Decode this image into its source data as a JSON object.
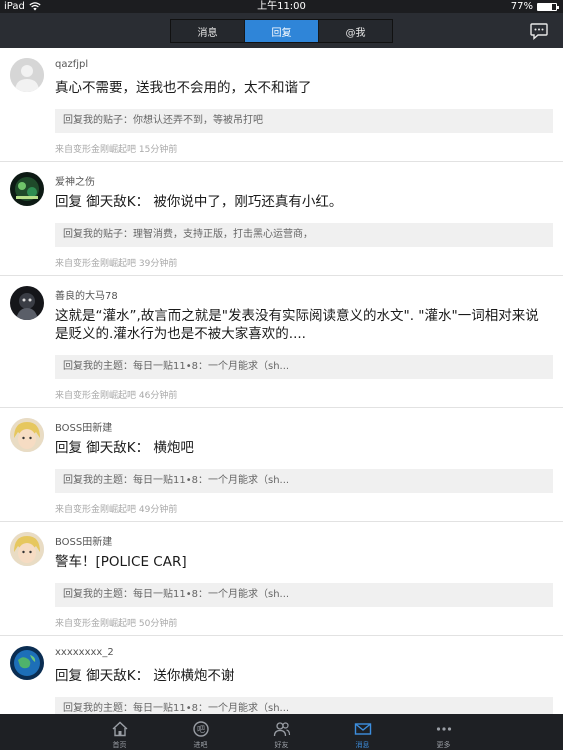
{
  "status": {
    "device": "iPad",
    "time": "上午11:00",
    "battery": "77%",
    "battery_level": 0.77
  },
  "nav": {
    "segments": [
      "消息",
      "回复",
      "@我"
    ],
    "active_segment": 1,
    "chat_icon": "chat-bubble-icon"
  },
  "replies": [
    {
      "user": "qazfjpl",
      "avatar": "default-avatar",
      "content": "真心不需要，送我也不会用的，太不和谐了",
      "quote": "回复我的贴子：你想认还弄不到，等被吊打吧",
      "meta": "来自变形金刚崛起吧   15分钟前"
    },
    {
      "user": "爱神之伤",
      "avatar": "avatar-green",
      "content": "回复 御天敌K： 被你说中了，刚巧还真有小红。",
      "quote": "回复我的贴子：理智消费，支持正版，打击黑心运营商，",
      "meta": "来自变形金刚崛起吧   39分钟前"
    },
    {
      "user": "善良的大马78",
      "avatar": "avatar-dark",
      "content": "这就是“灌水”,故言而之就是\"发表没有实际阅读意义的水文\". \"灌水\"一词相对来说是贬义的.灌水行为也是不被大家喜欢的....",
      "quote": "回复我的主题：每日一贴11•8：一个月能求（sh...",
      "meta": "来自变形金刚崛起吧   46分钟前"
    },
    {
      "user": "BOSS田新建",
      "avatar": "avatar-blonde",
      "content": "回复 御天敌K： 横炮吧",
      "quote": "回复我的主题：每日一贴11•8：一个月能求（sh...",
      "meta": "来自变形金刚崛起吧   49分钟前"
    },
    {
      "user": "BOSS田新建",
      "avatar": "avatar-blonde",
      "content": "警车！[POLICE CAR]",
      "quote": "回复我的主题：每日一贴11•8：一个月能求（sh...",
      "meta": "来自变形金刚崛起吧   50分钟前"
    },
    {
      "user": "xxxxxxxx_2",
      "avatar": "avatar-earth",
      "content": "回复 御天敌K： 送你横炮不谢",
      "quote": "回复我的主题：每日一贴11•8：一个月能求（sh...",
      "meta": ""
    }
  ],
  "tabs": [
    {
      "label": "首页",
      "icon": "home-icon"
    },
    {
      "label": "进吧",
      "icon": "forum-icon"
    },
    {
      "label": "好友",
      "icon": "friends-icon"
    },
    {
      "label": "消息",
      "icon": "mail-icon"
    },
    {
      "label": "更多",
      "icon": "more-icon"
    }
  ],
  "active_tab": 3,
  "colors": {
    "accent": "#2f85d8",
    "navbar": "#2a2d33",
    "tabbar": "#1e2024"
  }
}
